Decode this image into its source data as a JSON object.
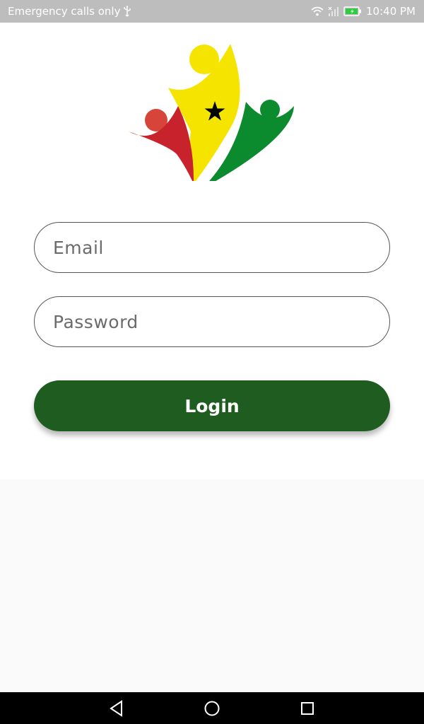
{
  "status_bar": {
    "carrier_text": "Emergency calls only",
    "time": "10:40 PM",
    "icons": [
      "usb-icon",
      "wifi-icon",
      "signal-icon",
      "battery-charging-icon"
    ],
    "battery_color": "#2ecc40"
  },
  "logo": {
    "icon": "people-star-logo",
    "colors": {
      "red": "#c8232c",
      "yellow": "#f5e400",
      "green": "#0b8a2e",
      "star": "#000000"
    }
  },
  "form": {
    "email_placeholder": "Email",
    "password_placeholder": "Password",
    "login_label": "Login"
  },
  "theme": {
    "button_color": "#1f5c20",
    "page_bg": "#fafafa",
    "card_bg": "#ffffff"
  },
  "nav_bar": {
    "icons": [
      "back-icon",
      "home-icon",
      "recent-apps-icon"
    ]
  }
}
